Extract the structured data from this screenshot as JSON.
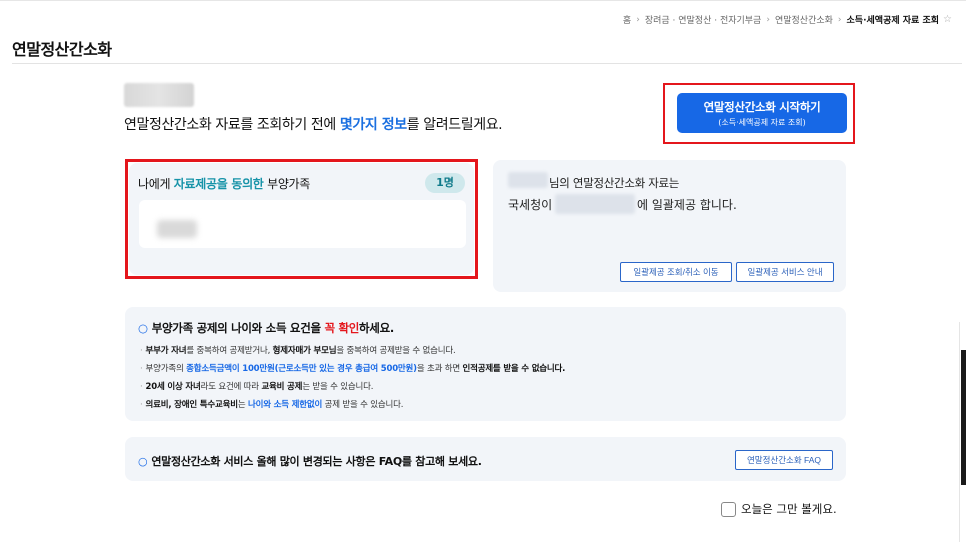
{
  "breadcrumb": {
    "items": [
      "홈",
      "장려금 · 연말정산 · 전자기부금",
      "연말정산간소화",
      "소득·세액공제 자료 조회"
    ],
    "separator": "›",
    "favorite_icon": "star-outline-icon"
  },
  "page_title": "연말정산간소화",
  "intro": {
    "prefix": "연말정산간소화 자료를 조회하기 전에 ",
    "highlight": "몇가지 정보",
    "suffix": "를 알려드릴게요."
  },
  "start_button": {
    "line1": "연말정산간소화 시작하기",
    "line2": "(소득·세액공제 자료 조회)"
  },
  "dependents": {
    "title_prefix": "나에게 ",
    "title_highlight": "자료제공을 동의한",
    "title_suffix": " 부양가족",
    "count_badge": "1명"
  },
  "bulk_info": {
    "line1_suffix": "님의 연말정산간소화 자료는",
    "line2_prefix": "국세청이",
    "line2_suffix": "에 일괄제공 합니다.",
    "btn_view_cancel": "일괄제공 조회/취소 이동",
    "btn_guide": "일괄제공 서비스 안내"
  },
  "requirements": {
    "title_prefix": "부양가족 공제의 나이와 소득 요건을 ",
    "title_red": "꼭 확인",
    "title_suffix": "하세요.",
    "item1": {
      "b1": "부부가 자녀",
      "t1": "를 중복하여 공제받거나, ",
      "b2": "형제자매가 부모님",
      "t2": "을 중복하여 공제받을 수 없습니다."
    },
    "item2": {
      "t1": "부양가족의 ",
      "blue": "종합소득금액이 100만원(근로소득만 있는 경우 총급여 500만원)",
      "t2": "을 초과 하면 ",
      "b1": "인적공제를 받을 수 없습니다."
    },
    "item3": {
      "b1": "20세 이상 자녀",
      "t1": "라도 요건에 따라 ",
      "b2": "교육비 공제",
      "t2": "는 받을 수 있습니다."
    },
    "item4": {
      "b1": "의료비, 장애인 특수교육비",
      "t1": "는 ",
      "blue": "나이와 소득 제한없이",
      "t2": " 공제 받을 수 있습니다."
    }
  },
  "faq": {
    "text": "연말정산간소화 서비스 올해 많이 변경되는 사항은 FAQ를 참고해 보세요.",
    "button": "연말정산간소화 FAQ"
  },
  "dont_show_today": "오늘은 그만 볼게요.",
  "colors": {
    "primary_blue": "#1768e6",
    "highlight_teal": "#1693a8",
    "alert_red": "#e4161c",
    "card_bg": "#f2f5f9"
  }
}
